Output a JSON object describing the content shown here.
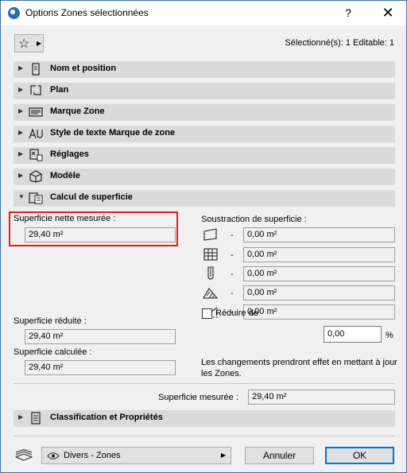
{
  "window": {
    "title": "Options Zones sélectionnées",
    "help": "?",
    "close": "✕"
  },
  "toolbar": {
    "selected_info": "Sélectionné(s): 1 Editable: 1"
  },
  "panels": [
    {
      "label": "Nom et position",
      "icon": "name-position-icon",
      "expanded": false
    },
    {
      "label": "Plan",
      "icon": "plan-icon",
      "expanded": false
    },
    {
      "label": "Marque Zone",
      "icon": "zone-stamp-icon",
      "expanded": false
    },
    {
      "label": "Style de texte Marque de zone",
      "icon": "text-style-icon",
      "expanded": false
    },
    {
      "label": "Réglages",
      "icon": "settings-icon",
      "expanded": false
    },
    {
      "label": "Modèle",
      "icon": "model-icon",
      "expanded": false
    },
    {
      "label": "Calcul de superficie",
      "icon": "area-calculation-icon",
      "expanded": true
    }
  ],
  "area": {
    "net_measured_label": "Superficie nette mesurée :",
    "net_measured_value": "29,40 m²",
    "subtraction_label": "Soustraction de superficie :",
    "subtractions": [
      {
        "icon": "wall-surface-icon",
        "dash": "-",
        "value": "0,00 m²"
      },
      {
        "icon": "grid-area-icon",
        "dash": "-",
        "value": "0,00 m²"
      },
      {
        "icon": "column-icon",
        "dash": "-",
        "value": "0,00 m²"
      },
      {
        "icon": "hatched-slope-icon",
        "dash": "-",
        "value": "0,00 m²"
      },
      {
        "icon": "low-ceiling-icon",
        "dash": "-",
        "value": "0,00 m²"
      }
    ],
    "reduced_label": "Superficie réduite :",
    "reduced_value": "29,40 m²",
    "calculated_label": "Superficie calculée :",
    "calculated_value": "29,40 m²",
    "reduce_by_label": "Réduire de",
    "reduce_by_value": "0,00",
    "reduce_by_unit": "%",
    "note": "Les changements prendront effet en mettant à jour les Zones.",
    "measured_label": "Superficie mesurée :",
    "measured_value": "29,40 m²"
  },
  "classification_panel": {
    "label": "Classification et Propriétés",
    "icon": "classification-icon"
  },
  "footer": {
    "layer_value": "Divers - Zones",
    "cancel_label": "Annuler",
    "ok_label": "OK"
  }
}
